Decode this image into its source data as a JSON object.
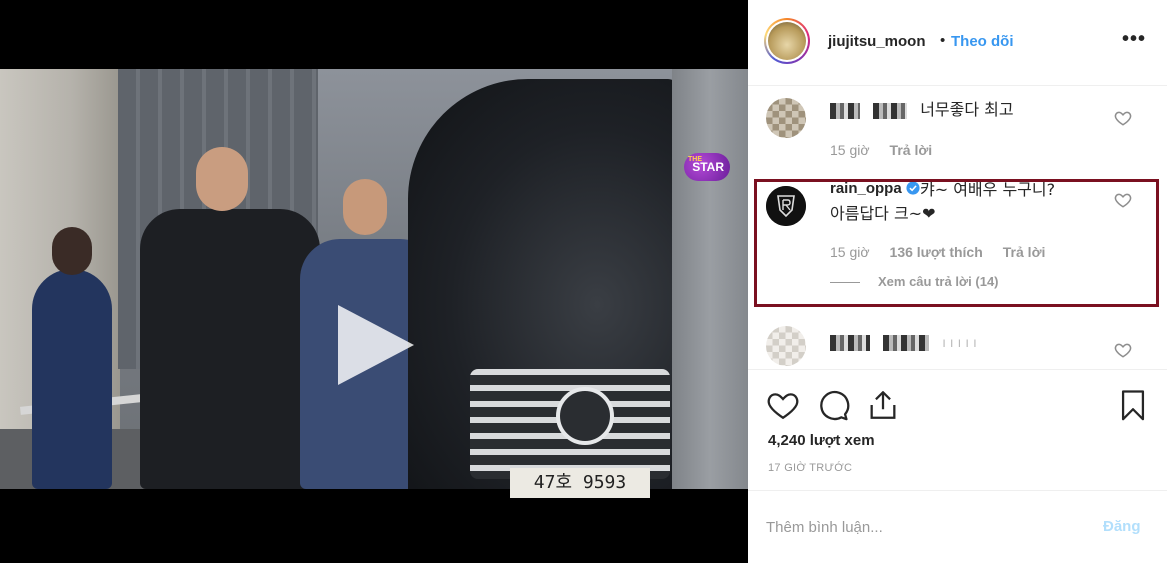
{
  "video": {
    "badge_small": "THE",
    "badge_text": "STAR",
    "plate_text": "47호 9593"
  },
  "post": {
    "username": "jiujitsu_moon",
    "separator": "•",
    "follow_label": "Theo dõi",
    "more_label": "•••"
  },
  "comments": [
    {
      "username_blurred": true,
      "text": "너무좋다 최고",
      "time": "15 giờ",
      "reply_label": "Trả lời"
    },
    {
      "username": "rain_oppa",
      "verified": true,
      "text_line1": "캬~ 여배우 누구니?",
      "text_line2": "아름답다 크~❤",
      "time": "15 giờ",
      "likes": "136 lượt thích",
      "reply_label": "Trả lời",
      "view_replies": "Xem câu trả lời (14)",
      "avatar_label": "RAIN"
    },
    {
      "username_blurred": true,
      "text": "ı ı ı ı ı"
    }
  ],
  "stats": {
    "views": "4,240 lượt xem",
    "time_ago": "17 GIỜ TRƯỚC"
  },
  "add_comment": {
    "placeholder": "Thêm bình luận...",
    "post_label": "Đăng"
  },
  "colors": {
    "link_blue": "#3897f0",
    "highlight_border": "#7a1020",
    "post_disabled": "#b2dffc"
  }
}
